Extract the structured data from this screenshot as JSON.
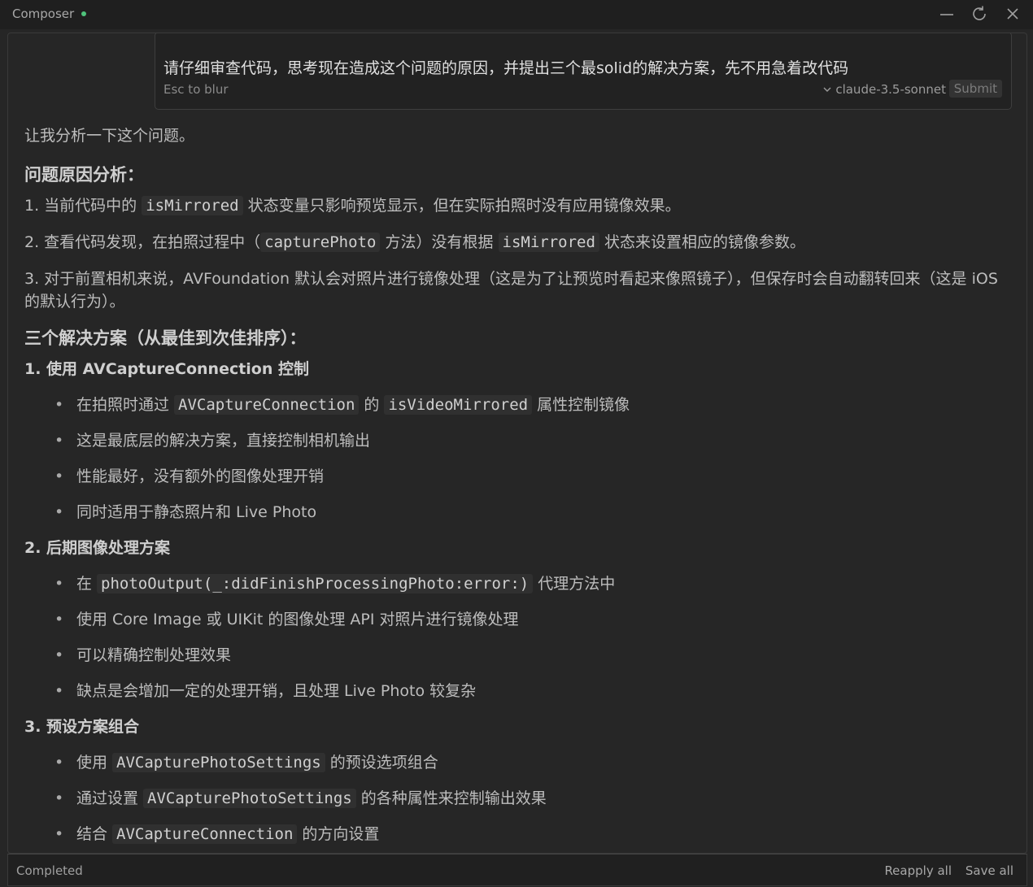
{
  "window": {
    "title": "Composer",
    "status_color": "#4fc37b",
    "controls": [
      "minimize-icon",
      "refresh-icon",
      "close-icon"
    ]
  },
  "prompt": {
    "text": "请仔细审查代码，思考现在造成这个问题的原因，并提出三个最solid的解决方案，先不用急着改代码",
    "blur_hint": "Esc to blur",
    "model": "claude-3.5-sonnet",
    "submit_label": "Submit"
  },
  "response": {
    "intro": "让我分析一下这个问题。",
    "h1": "问题原因分析：",
    "p1": {
      "a": "1. 当前代码中的 ",
      "code": "isMirrored",
      "b": " 状态变量只影响预览显示，但在实际拍照时没有应用镜像效果。"
    },
    "p2": {
      "a": "2. 查看代码发现，在拍照过程中（",
      "code": "capturePhoto",
      "b": " 方法）没有根据 ",
      "code2": "isMirrored",
      "c": " 状态来设置相应的镜像参数。"
    },
    "p3": "3. 对于前置相机来说，AVFoundation 默认会对照片进行镜像处理（这是为了让预览时看起来像照镜子），但保存时会自动翻转回来（这是 iOS 的默认行为）。",
    "h2": "三个解决方案（从最佳到次佳排序）：",
    "s1": {
      "title": "1. 使用 AVCaptureConnection 控制",
      "b1": {
        "a": "在拍照时通过 ",
        "code": "AVCaptureConnection",
        "b": " 的 ",
        "code2": "isVideoMirrored",
        "c": " 属性控制镜像"
      },
      "b2": "这是最底层的解决方案，直接控制相机输出",
      "b3": "性能最好，没有额外的图像处理开销",
      "b4": "同时适用于静态照片和 Live Photo"
    },
    "s2": {
      "title": "2. 后期图像处理方案",
      "b1": {
        "a": "在 ",
        "code": "photoOutput(_:didFinishProcessingPhoto:error:)",
        "b": " 代理方法中"
      },
      "b2": "使用 Core Image 或 UIKit 的图像处理 API 对照片进行镜像处理",
      "b3": "可以精确控制处理效果",
      "b4": "缺点是会增加一定的处理开销，且处理 Live Photo 较复杂"
    },
    "s3": {
      "title": "3. 预设方案组合",
      "b1": {
        "a": "使用 ",
        "code": "AVCapturePhotoSettings",
        "b": " 的预设选项组合"
      },
      "b2": {
        "a": "通过设置 ",
        "code": "AVCapturePhotoSettings",
        "b": " 的各种属性来控制输出效果"
      },
      "b3": {
        "a": "结合 ",
        "code": "AVCaptureConnection",
        "b": " 的方向设置"
      }
    }
  },
  "footer": {
    "status": "Completed",
    "reapply_label": "Reapply all",
    "save_label": "Save all"
  }
}
